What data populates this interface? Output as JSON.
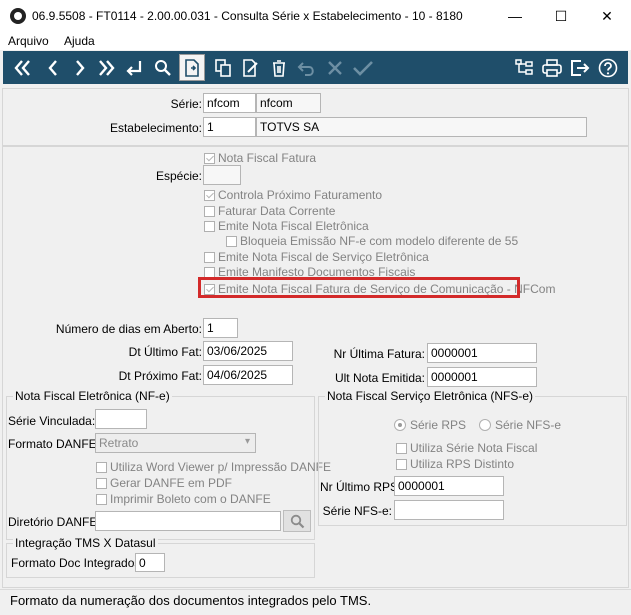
{
  "window": {
    "title": "06.9.5508 - FT0114 - 2.00.00.031 - Consulta Série x Estabelecimento - 10 - 8180",
    "minimize": "—",
    "maximize": "☐",
    "close": "✕"
  },
  "menu": [
    "Arquivo",
    "Ajuda"
  ],
  "toolbar_icons": [
    "first-icon",
    "previous-icon",
    "next-icon",
    "last-icon",
    "goto-icon",
    "search-icon",
    "new-icon",
    "copy-icon",
    "edit-icon",
    "delete-icon",
    "undo-icon",
    "cancel-icon",
    "confirm-icon",
    "structure-icon",
    "print-icon",
    "exit-icon",
    "help-icon"
  ],
  "header": {
    "serie_label": "Série:",
    "serie_value": "nfcom",
    "serie_desc": "nfcom",
    "estab_label": "Estabelecimento:",
    "estab_value": "1",
    "estab_desc": "TOTVS SA"
  },
  "options": {
    "nota_fiscal_fatura": "Nota Fiscal Fatura",
    "especie_label": "Espécie:",
    "especie_value": "",
    "controla_proximo": "Controla Próximo Faturamento",
    "faturar_data": "Faturar Data Corrente",
    "emite_nfe": "Emite Nota Fiscal Eletrônica",
    "bloqueia_emissao": "Bloqueia Emissão NF-e com modelo diferente de 55",
    "emite_nfse": "Emite Nota Fiscal de Serviço Eletrônica",
    "emite_manifesto": "Emite Manifesto Documentos Fiscais",
    "emite_nfcom": "Emite Nota Fiscal Fatura de Serviço de Comunicação - NFCom"
  },
  "datas": {
    "dias_aberto_label": "Número de dias em Aberto:",
    "dias_aberto_value": "1",
    "dt_ultimo_label": "Dt Último Fat:",
    "dt_ultimo_value": "03/06/2025",
    "dt_proximo_label": "Dt Próximo Fat:",
    "dt_proximo_value": "04/06/2025",
    "nr_ultima_label": "Nr Última Fatura:",
    "nr_ultima_value": "0000001",
    "ult_nota_label": "Ult Nota Emitida:",
    "ult_nota_value": "0000001"
  },
  "nfe": {
    "legend": "Nota Fiscal Eletrônica (NF-e)",
    "serie_vinculada_label": "Série Vinculada:",
    "serie_vinculada_value": "",
    "formato_label": "Formato DANFE:",
    "formato_value": "Retrato",
    "word_viewer": "Utiliza Word Viewer p/ Impressão DANFE",
    "gerar_pdf": "Gerar DANFE em PDF",
    "imprimir_boleto": "Imprimir Boleto com o DANFE",
    "diretorio_label": "Diretório DANFE:",
    "diretorio_value": ""
  },
  "nfse": {
    "legend": "Nota Fiscal Serviço Eletrônica (NFS-e)",
    "serie_rps": "Série RPS",
    "serie_nfse": "Série NFS-e",
    "utiliza_serie_nota": "Utiliza Série Nota Fiscal",
    "utiliza_rps": "Utiliza RPS Distinto",
    "nr_ultimo_rps_label": "Nr Último RPS:",
    "nr_ultimo_rps_value": "0000001",
    "serie_nfse_label": "Série NFS-e:",
    "serie_nfse_value": ""
  },
  "tms": {
    "legend": "Integração TMS X Datasul",
    "formato_doc_label": "Formato Doc Integrados:",
    "formato_doc_value": "0"
  },
  "status": "Formato da numeração dos documentos integrados pelo TMS."
}
